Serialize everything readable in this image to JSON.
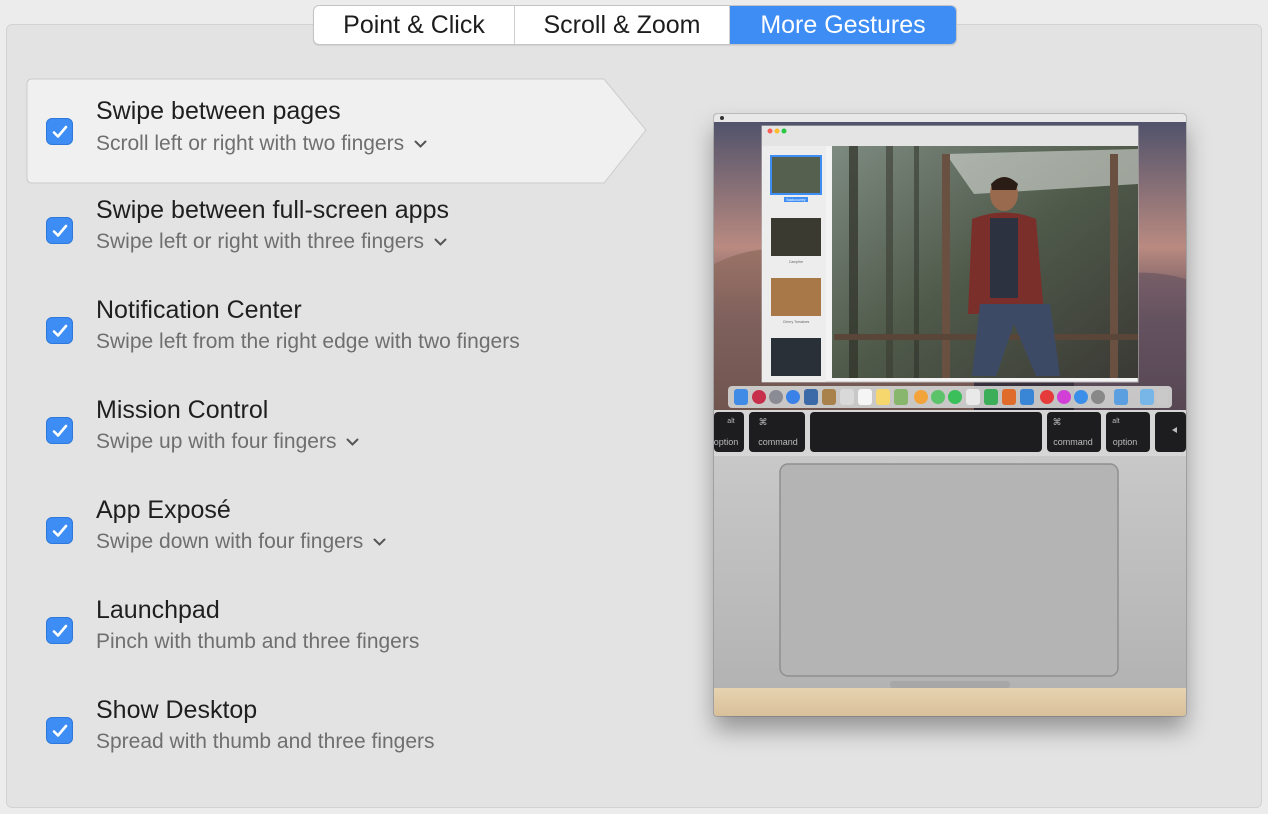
{
  "tabs": [
    {
      "label": "Point & Click",
      "active": false
    },
    {
      "label": "Scroll & Zoom",
      "active": false
    },
    {
      "label": "More Gestures",
      "active": true
    }
  ],
  "gestures": [
    {
      "title": "Swipe between pages",
      "subtitle": "Scroll left or right with two fingers",
      "checked": true,
      "has_dropdown": true,
      "selected": true
    },
    {
      "title": "Swipe between full-screen apps",
      "subtitle": "Swipe left or right with three fingers",
      "checked": true,
      "has_dropdown": true,
      "selected": false
    },
    {
      "title": "Notification Center",
      "subtitle": "Swipe left from the right edge with two fingers",
      "checked": true,
      "has_dropdown": false,
      "selected": false
    },
    {
      "title": "Mission Control",
      "subtitle": "Swipe up with four fingers",
      "checked": true,
      "has_dropdown": true,
      "selected": false
    },
    {
      "title": "App Exposé",
      "subtitle": "Swipe down with four fingers",
      "checked": true,
      "has_dropdown": true,
      "selected": false
    },
    {
      "title": "Launchpad",
      "subtitle": "Pinch with thumb and three fingers",
      "checked": true,
      "has_dropdown": false,
      "selected": false
    },
    {
      "title": "Show Desktop",
      "subtitle": "Spread with thumb and three fingers",
      "checked": true,
      "has_dropdown": false,
      "selected": false
    }
  ],
  "preview": {
    "keys": {
      "left_alt": "alt",
      "left_option": "option",
      "left_cmd_symbol": "⌘",
      "left_command": "command",
      "right_cmd_symbol": "⌘",
      "right_command": "command",
      "right_alt": "alt",
      "right_option": "option"
    },
    "sidebar_labels": [
      "Backcountry",
      "Campfire",
      "Cherry Tomatoes"
    ]
  },
  "colors": {
    "accent": "#3d8df5",
    "panel": "#e3e3e3",
    "title_text": "#1f1f1f",
    "subtitle_text": "#6f6f6f"
  }
}
